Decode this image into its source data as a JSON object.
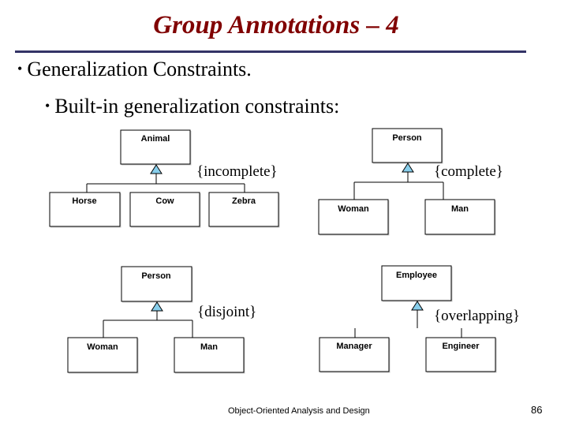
{
  "slide": {
    "title": "Group Annotations – 4",
    "bullets": [
      {
        "marker": "•",
        "text": "Generalization Constraints."
      },
      {
        "marker": "•",
        "text": "Built-in generalization constraints:"
      }
    ],
    "footer": "Object-Oriented Analysis and Design",
    "page_number": "86",
    "colors": {
      "title": "#800000",
      "rule": "#333366",
      "generalization_arrow": "#87ceeb"
    }
  },
  "diagrams": [
    {
      "id": "incomplete",
      "superclass": "Animal",
      "subclasses": [
        "Horse",
        "Cow",
        "Zebra"
      ],
      "constraint": "{incomplete}"
    },
    {
      "id": "complete",
      "superclass": "Person",
      "subclasses": [
        "Woman",
        "Man"
      ],
      "constraint": "{complete}"
    },
    {
      "id": "disjoint",
      "superclass": "Person",
      "subclasses": [
        "Woman",
        "Man"
      ],
      "constraint": "{disjoint}"
    },
    {
      "id": "overlapping",
      "superclass": "Employee",
      "subclasses": [
        "Manager",
        "Engineer"
      ],
      "constraint": "{overlapping}"
    }
  ]
}
